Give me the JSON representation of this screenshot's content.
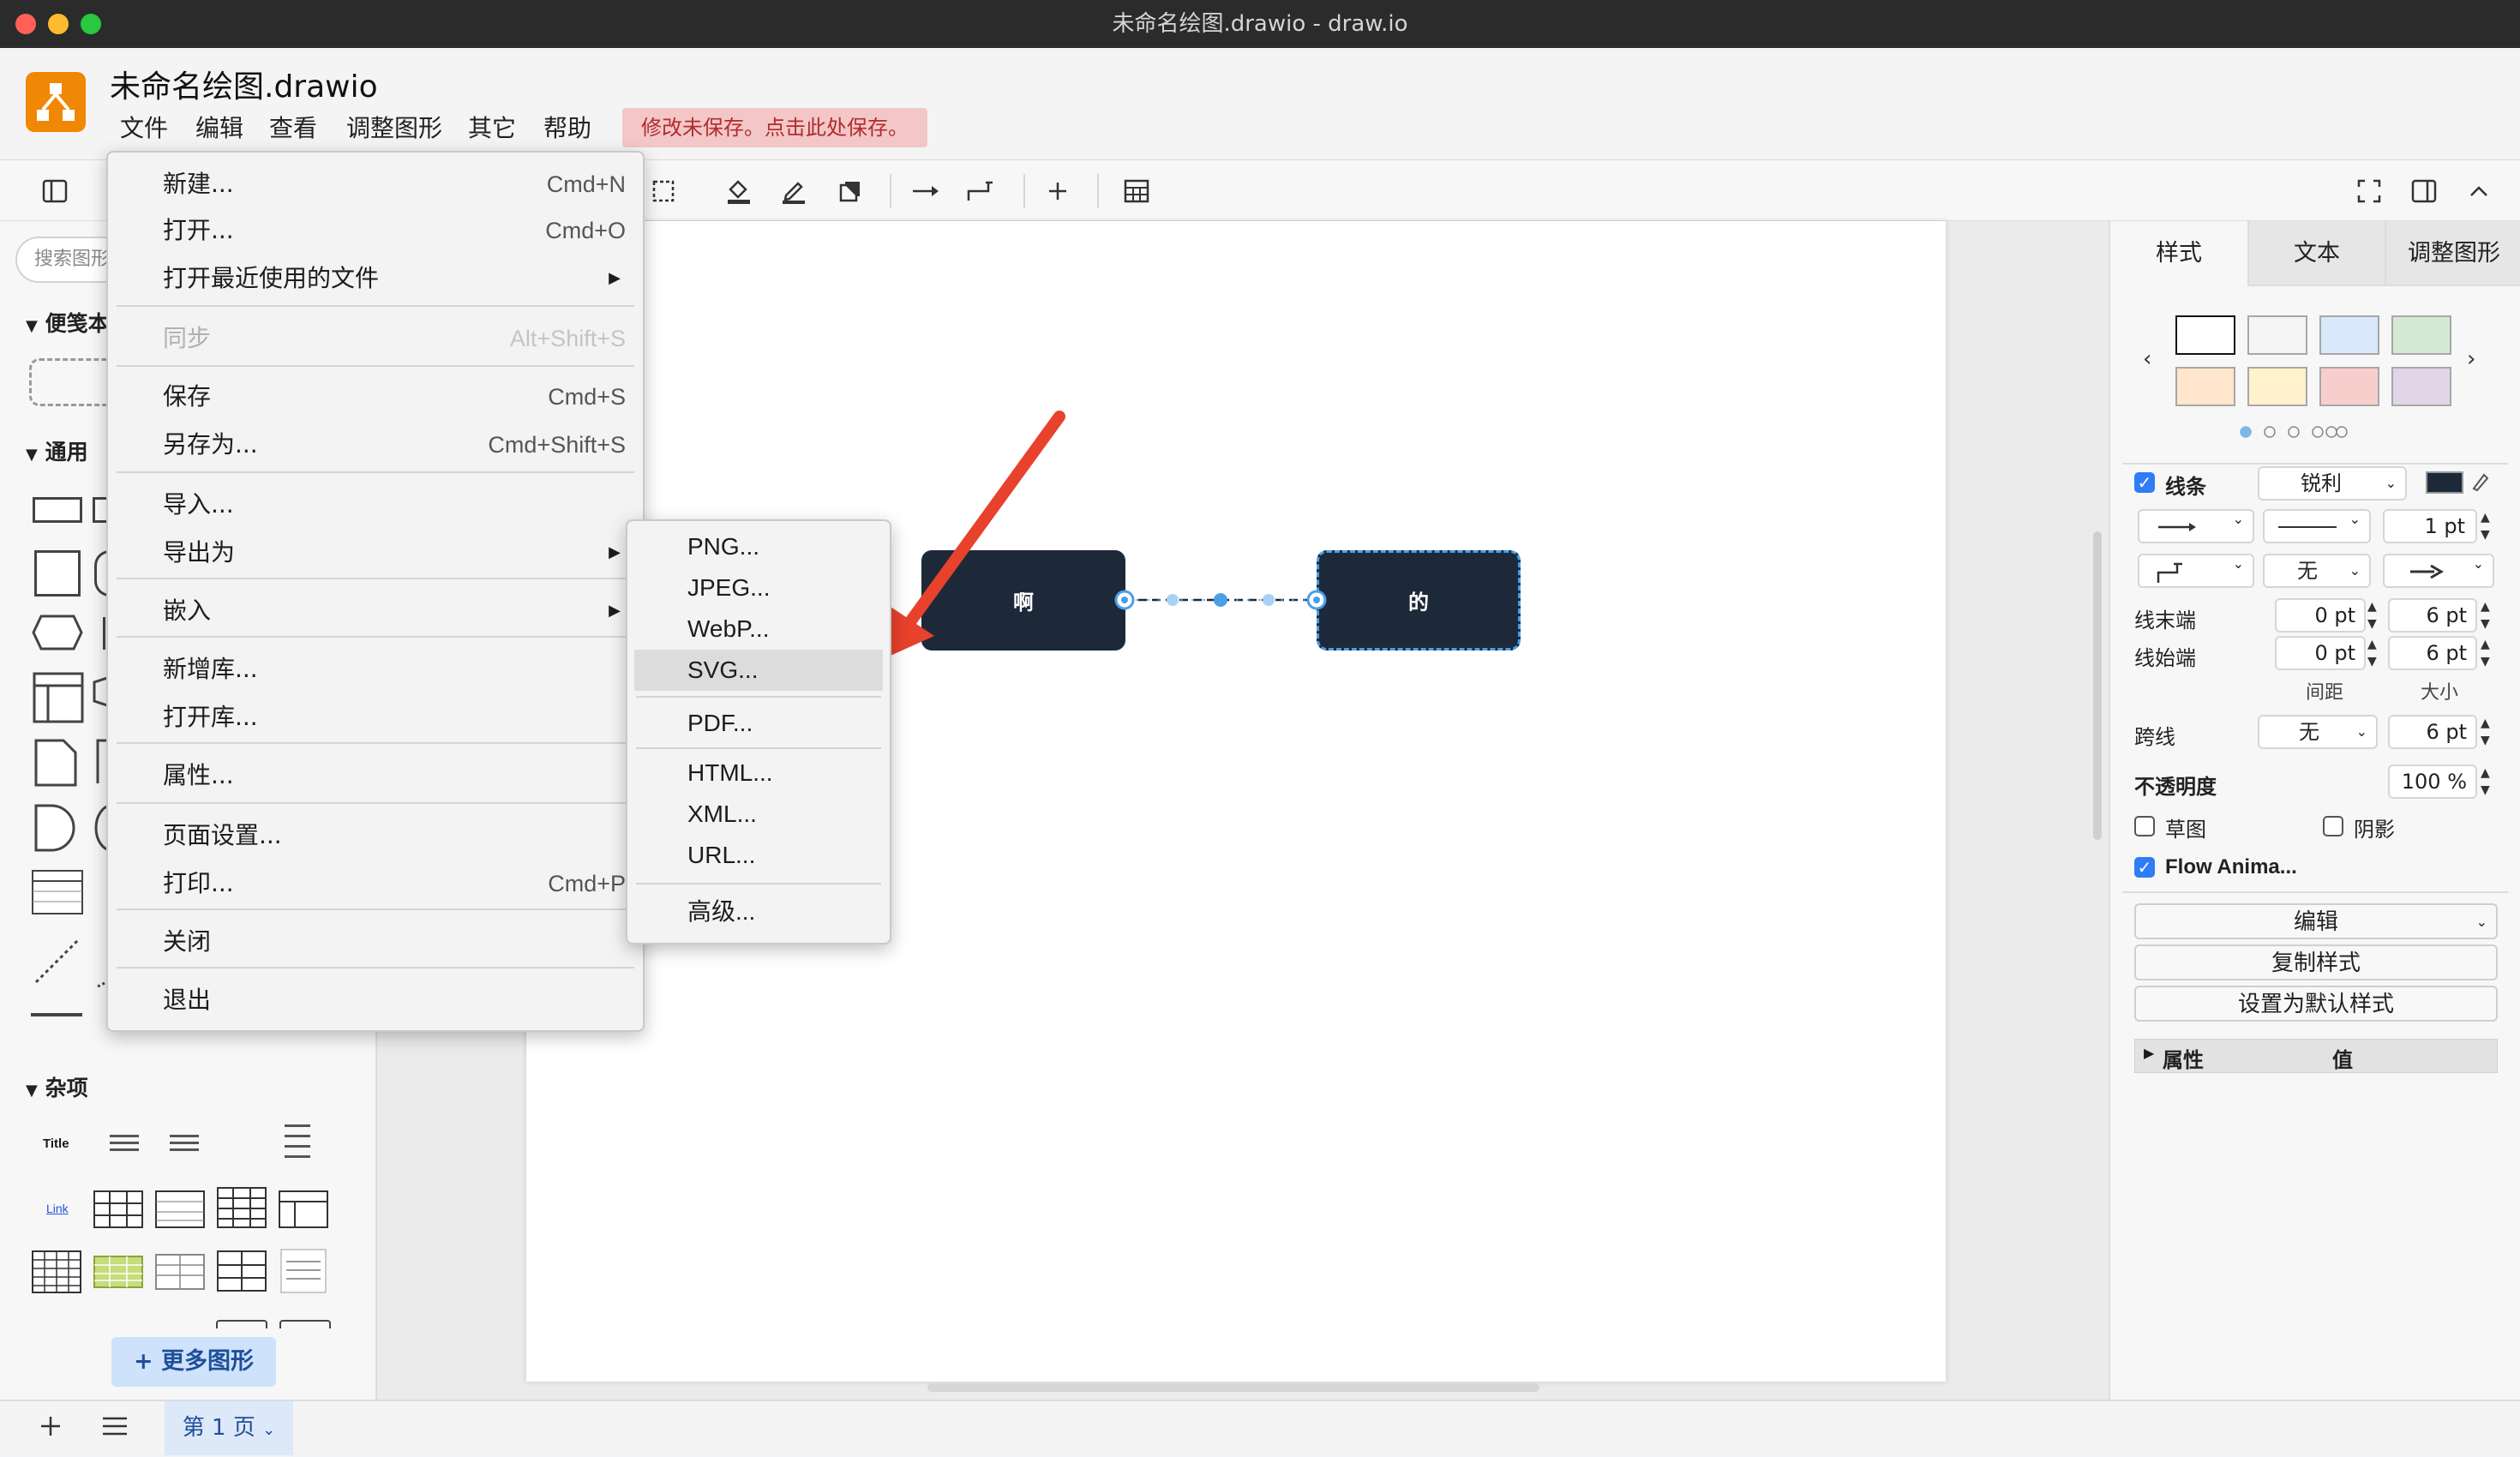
{
  "window": {
    "title": "未命名绘图.drawio - draw.io"
  },
  "app": {
    "filename": "未命名绘图.drawio",
    "menubar": [
      "文件",
      "编辑",
      "查看",
      "调整图形",
      "其它",
      "帮助"
    ],
    "unsaved_notice": "修改未保存。点击此处保存。"
  },
  "sidebar": {
    "search_placeholder": "搜索图形",
    "sections": {
      "scratchpad": "便笺本",
      "general": "通用",
      "misc": "杂项"
    },
    "misc_preview": {
      "title": "Title",
      "link": "Link"
    },
    "more_shapes": "+ 更多图形"
  },
  "file_menu": {
    "items": [
      {
        "label": "新建...",
        "shortcut": "Cmd+N"
      },
      {
        "label": "打开...",
        "shortcut": "Cmd+O"
      },
      {
        "label": "打开最近使用的文件",
        "submenu": true
      },
      {
        "label": "同步",
        "shortcut": "Alt+Shift+S",
        "disabled": true
      },
      {
        "label": "保存",
        "shortcut": "Cmd+S"
      },
      {
        "label": "另存为...",
        "shortcut": "Cmd+Shift+S"
      },
      {
        "label": "导入..."
      },
      {
        "label": "导出为",
        "submenu": true
      },
      {
        "label": "嵌入",
        "submenu": true
      },
      {
        "label": "新增库..."
      },
      {
        "label": "打开库..."
      },
      {
        "label": "属性..."
      },
      {
        "label": "页面设置..."
      },
      {
        "label": "打印...",
        "shortcut": "Cmd+P"
      },
      {
        "label": "关闭"
      },
      {
        "label": "退出"
      }
    ]
  },
  "export_submenu": {
    "items": [
      "PNG...",
      "JPEG...",
      "WebP...",
      "SVG...",
      "PDF...",
      "HTML...",
      "XML...",
      "URL...",
      "高级..."
    ],
    "highlighted": "SVG..."
  },
  "canvas": {
    "nodes": [
      {
        "label": "啊"
      },
      {
        "label": "的"
      }
    ],
    "annotation_color": "#e8412c",
    "node_color": "#1d2939",
    "edge_color": "#4a9fe8"
  },
  "format_panel": {
    "tabs": [
      "样式",
      "文本",
      "调整图形"
    ],
    "active_tab": "样式",
    "swatches": [
      "#ffffff",
      "#f5f5f5",
      "#dae8fc",
      "#d5e8d4",
      "#ffe6cc",
      "#fff2cc",
      "#f8cecc",
      "#e1d5e7"
    ],
    "line": {
      "label": "线条",
      "checked": true,
      "style": "锐利",
      "color": "#1d2939"
    },
    "width": "1 pt",
    "waypoint": "无",
    "line_end": {
      "label": "线末端",
      "spacing": "0 pt",
      "size": "6 pt"
    },
    "line_start": {
      "label": "线始端",
      "spacing": "0 pt",
      "size": "6 pt"
    },
    "spacing_label": "间距",
    "size_label": "大小",
    "jump": {
      "label": "跨线",
      "style": "无",
      "size": "6 pt"
    },
    "opacity": {
      "label": "不透明度",
      "value": "100 %"
    },
    "sketch": {
      "label": "草图",
      "checked": false
    },
    "shadow": {
      "label": "阴影",
      "checked": false
    },
    "flow_animation": {
      "label": "Flow Anima...",
      "checked": true
    },
    "edit_button": "编辑",
    "copy_style_button": "复制样式",
    "set_default_button": "设置为默认样式",
    "property_header": {
      "property": "属性",
      "value": "值"
    }
  },
  "bottom": {
    "page_tab": "第 1 页"
  }
}
